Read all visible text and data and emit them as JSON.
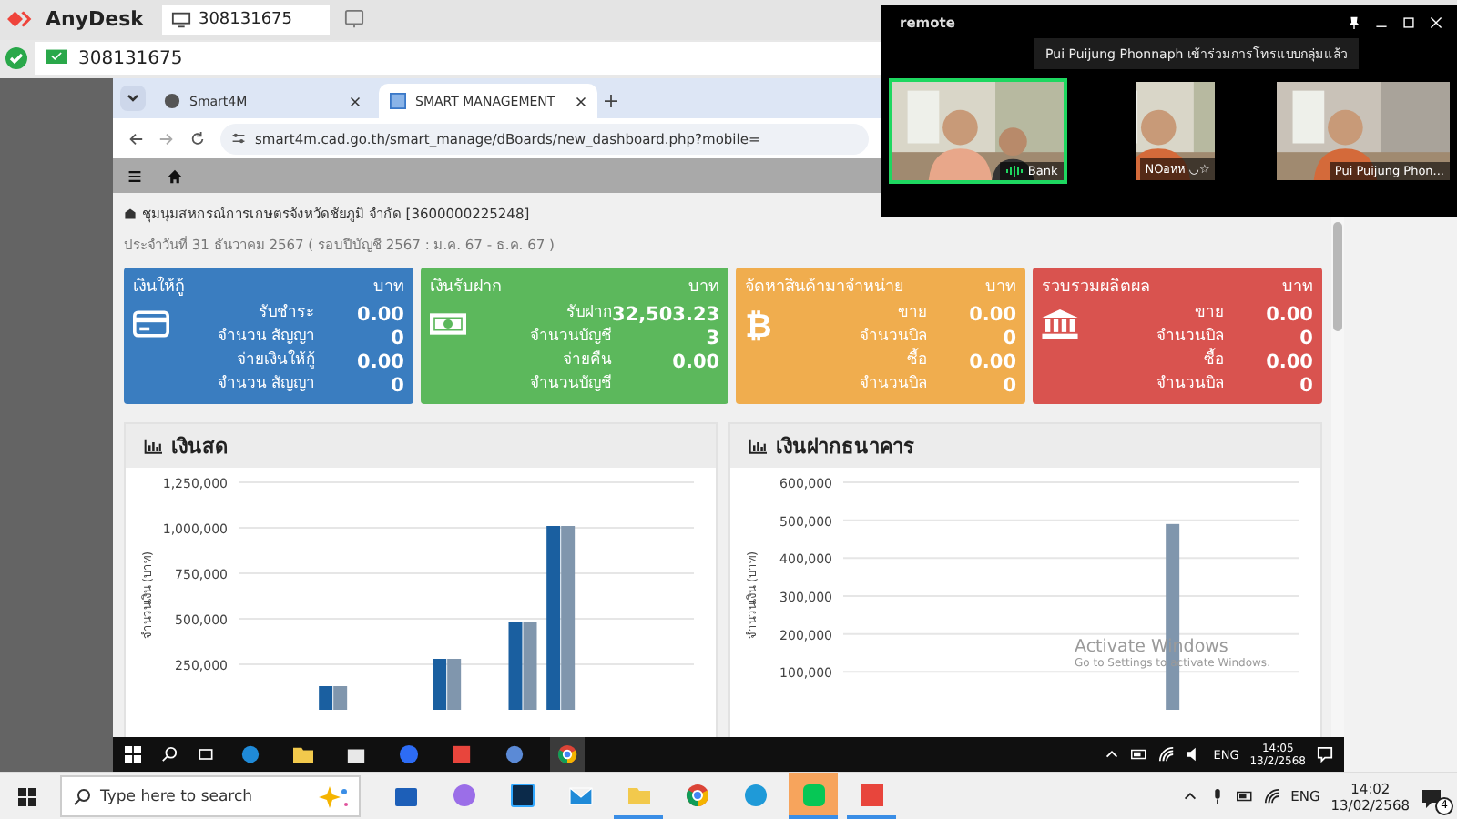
{
  "anydesk": {
    "app_name": "AnyDesk",
    "tab": "308131675",
    "address": "308131675",
    "connected": true
  },
  "browser": {
    "tabs": [
      {
        "title": "Smart4M",
        "selected": false
      },
      {
        "title": "SMART MANAGEMENT",
        "selected": true
      }
    ],
    "url": "smart4m.cad.go.th/smart_manage/dBoards/new_dashboard.php?mobile="
  },
  "dashboard": {
    "organization": "ชุมนุมสหกรณ์การเกษตรจังหวัดชัยภูมิ จำกัด [3600000225248]",
    "period": "ประจำวันที่ 31 ธันวาคม 2567 ( รอบปีบัญชี 2567 : ม.ค. 67 - ธ.ค. 67 )",
    "cards": [
      {
        "title": "เงินให้กู้",
        "unit": "บาท",
        "color": "#3a7dc0",
        "rows": [
          {
            "label": "รับชำระ",
            "value": "0.00"
          },
          {
            "label": "จำนวน สัญญา",
            "value": "0"
          },
          {
            "label": "จ่ายเงินให้กู้",
            "value": "0.00"
          },
          {
            "label": "จำนวน สัญญา",
            "value": "0"
          }
        ]
      },
      {
        "title": "เงินรับฝาก",
        "unit": "บาท",
        "color": "#5cb85c",
        "rows": [
          {
            "label": "รับฝาก",
            "value": "32,503.23"
          },
          {
            "label": "จำนวนบัญชี",
            "value": "3"
          },
          {
            "label": "จ่ายคืน",
            "value": "0.00"
          },
          {
            "label": "จำนวนบัญชี"
          }
        ]
      },
      {
        "title": "จัดหาสินค้ามาจำหน่าย",
        "unit": "บาท",
        "color": "#f0ad4e",
        "glyph": "₿",
        "rows": [
          {
            "label": "ขาย",
            "value": "0.00"
          },
          {
            "label": "จำนวนบิล",
            "value": "0"
          },
          {
            "label": "ซื้อ",
            "value": "0.00"
          },
          {
            "label": "จำนวนบิล",
            "value": "0"
          }
        ]
      },
      {
        "title": "รวบรวมผลิตผล",
        "unit": "บาท",
        "color": "#d9534f",
        "rows": [
          {
            "label": "ขาย",
            "value": "0.00"
          },
          {
            "label": "จำนวนบิล",
            "value": "0"
          },
          {
            "label": "ซื้อ",
            "value": "0.00"
          },
          {
            "label": "จำนวนบิล",
            "value": "0"
          }
        ]
      }
    ],
    "panels": [
      {
        "title": "เงินสด",
        "chart_data": {
          "type": "bar",
          "grid": true,
          "ylabel": "จำนวนเงิน (บาท)",
          "ylim": [
            0,
            1250000
          ],
          "yticks": [
            {
              "value": 250000,
              "label": "250,000"
            },
            {
              "value": 500000,
              "label": "500,000"
            },
            {
              "value": 750000,
              "label": "750,000"
            },
            {
              "value": 1000000,
              "label": "1,000,000"
            },
            {
              "value": 1250000,
              "label": "1,250,000"
            }
          ],
          "series": [
            {
              "color": "#1a5fa0",
              "values": [
                null,
                null,
                130000,
                null,
                null,
                280000,
                null,
                480000,
                1010000,
                null,
                null,
                null
              ]
            },
            {
              "color": "#8096ad",
              "values": [
                null,
                null,
                130000,
                null,
                null,
                280000,
                null,
                480000,
                1010000,
                null,
                null,
                null
              ]
            }
          ]
        }
      },
      {
        "title": "เงินฝากธนาคาร",
        "chart_data": {
          "type": "bar",
          "grid": true,
          "ylabel": "จำนวนเงิน (บาท)",
          "ylim": [
            0,
            600000
          ],
          "yticks": [
            {
              "value": 100000,
              "label": "100,000"
            },
            {
              "value": 200000,
              "label": "200,000"
            },
            {
              "value": 300000,
              "label": "300,000"
            },
            {
              "value": 400000,
              "label": "400,000"
            },
            {
              "value": 500000,
              "label": "500,000"
            },
            {
              "value": 600000,
              "label": "600,000"
            }
          ],
          "series": [
            {
              "color": "#8096ad",
              "values": [
                null,
                null,
                null,
                null,
                null,
                null,
                null,
                null,
                490000,
                null,
                null,
                null
              ]
            }
          ]
        }
      }
    ]
  },
  "activation_notice": {
    "title": "Activate Windows",
    "text": "Go to Settings to activate Windows."
  },
  "remote_taskbar": {
    "apps": [
      {
        "active": false
      },
      {
        "active": false
      },
      {
        "active": false
      },
      {
        "active": false
      },
      {
        "active": false
      },
      {
        "active": false
      },
      {
        "active": true
      }
    ],
    "language": "ENG",
    "time": "14:05",
    "date": "13/2/2568"
  },
  "video_call": {
    "title": "remote",
    "toast": "Pui Puijung Phonnaph เข้าร่วมการโทรแบบกลุ่มแล้ว",
    "participants": [
      {
        "name": "Bank",
        "speaking": true
      },
      {
        "name": "NOอหห ◡☆",
        "speaking": false
      },
      {
        "name": "Pui Puijung Phon...",
        "speaking": false
      }
    ]
  },
  "taskbar": {
    "search_placeholder": "Type here to search",
    "apps": [
      {
        "open": false,
        "attention": false
      },
      {
        "open": false,
        "attention": false
      },
      {
        "open": false,
        "attention": false
      },
      {
        "open": false,
        "attention": false
      },
      {
        "open": true,
        "attention": false
      },
      {
        "open": false,
        "attention": false
      },
      {
        "open": false,
        "attention": false
      },
      {
        "open": true,
        "attention": true
      },
      {
        "open": true,
        "attention": false
      }
    ],
    "language": "ENG",
    "time": "14:02",
    "date": "13/02/2568",
    "notifications": "4"
  }
}
